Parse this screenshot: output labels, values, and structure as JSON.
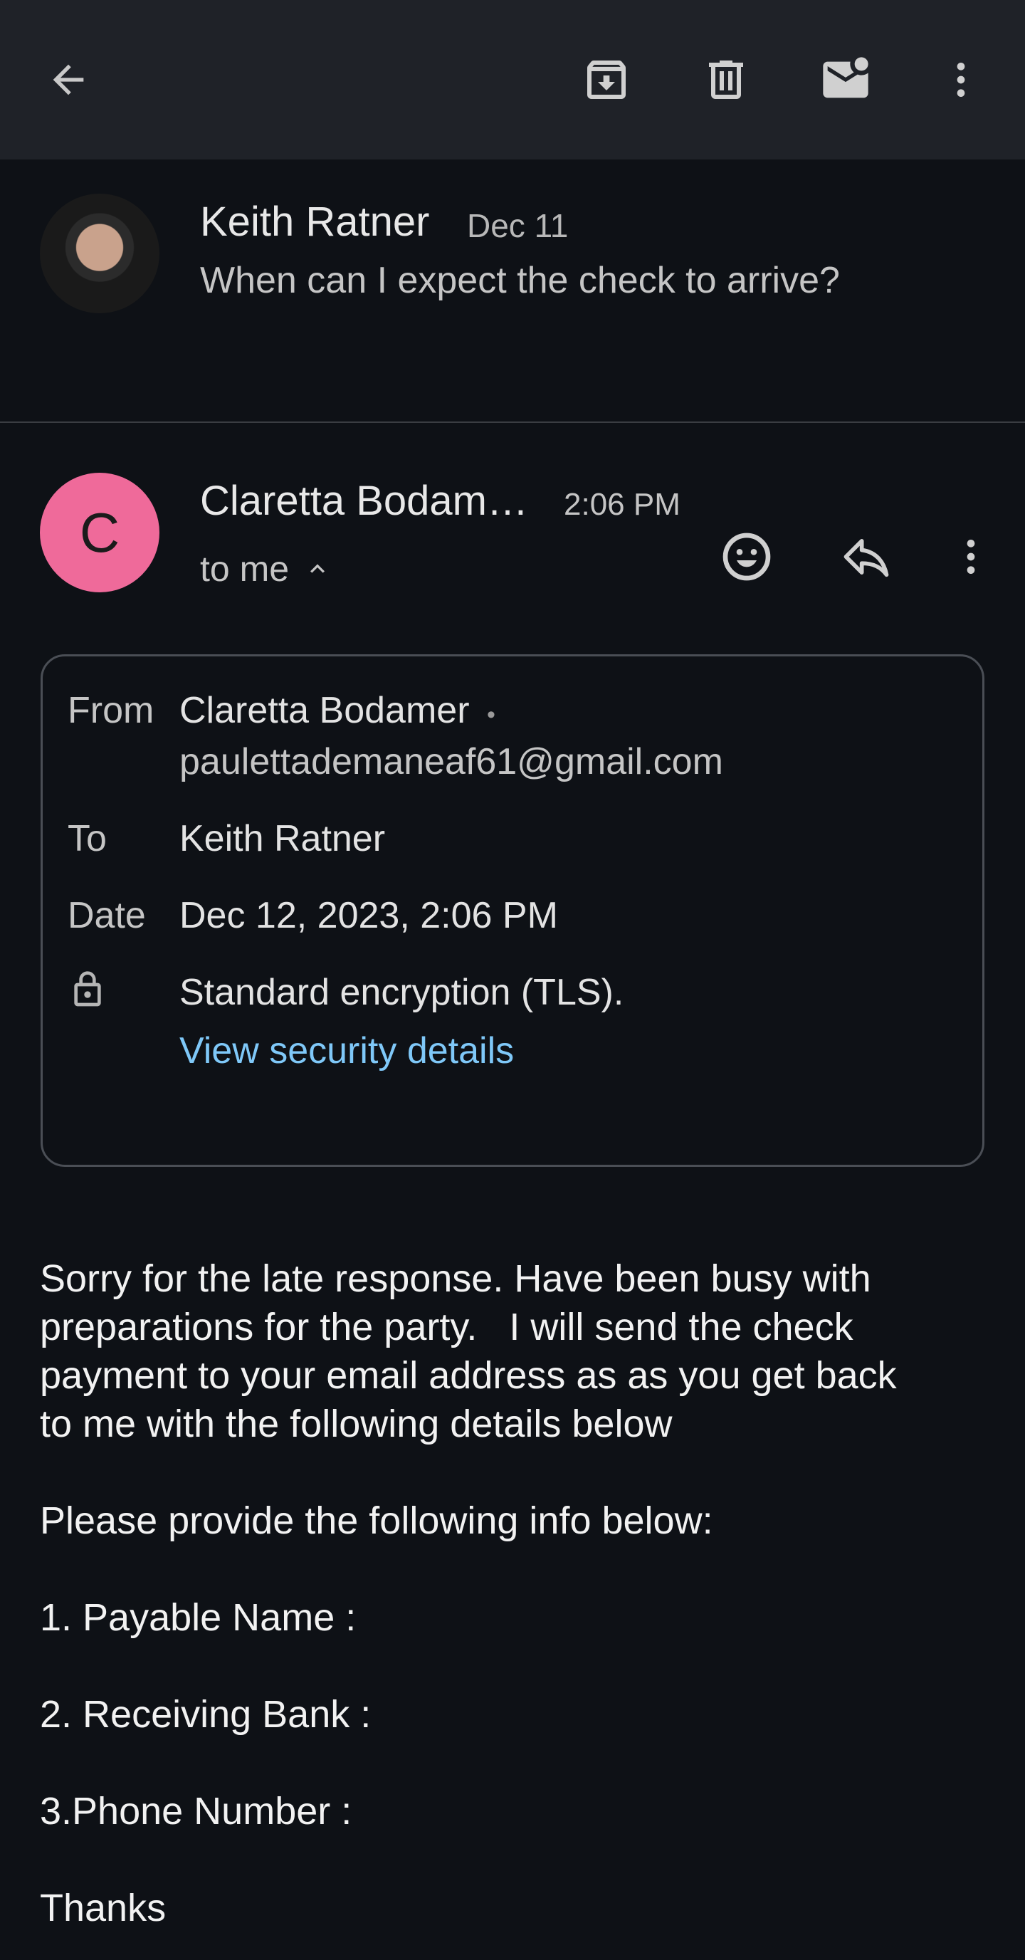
{
  "toolbar": {
    "back": "back-arrow-icon",
    "archive": "archive-icon",
    "delete": "trash-icon",
    "mark_unread": "mark-unread-icon",
    "more": "more-vert-icon"
  },
  "previous_message": {
    "sender": "Keith Ratner",
    "date": "Dec 11",
    "snippet": "When can I expect the check to arrive?"
  },
  "message": {
    "avatar_letter": "C",
    "avatar_color": "#ef6a9a",
    "sender": "Claretta Bodam…",
    "time": "2:06 PM",
    "to": "to me",
    "details": {
      "from_label": "From",
      "from_name": "Claretta Bodamer",
      "from_sep": "•",
      "from_email": "paulettademaneaf61@gmail.com",
      "to_label": "To",
      "to_value": "Keith Ratner",
      "date_label": "Date",
      "date_value": "Dec 12, 2023, 2:06 PM",
      "encryption": "Standard encryption (TLS).",
      "security_link": "View security details"
    },
    "body": {
      "line1": "Sorry for the late response. Have been busy with",
      "line2": "preparations for the party.   I will send the check",
      "line3": "payment to your email address as as you get back",
      "line4": "to me with the following details below",
      "p2": "Please provide the following info below:",
      "item1": "1. Payable Name :",
      "item2": "2. Receiving Bank :",
      "item3": "3.Phone Number :",
      "closing": "Thanks"
    }
  },
  "colors": {
    "background": "#0e1116",
    "toolbar": "#1f2228",
    "link": "#7fc8f8"
  }
}
